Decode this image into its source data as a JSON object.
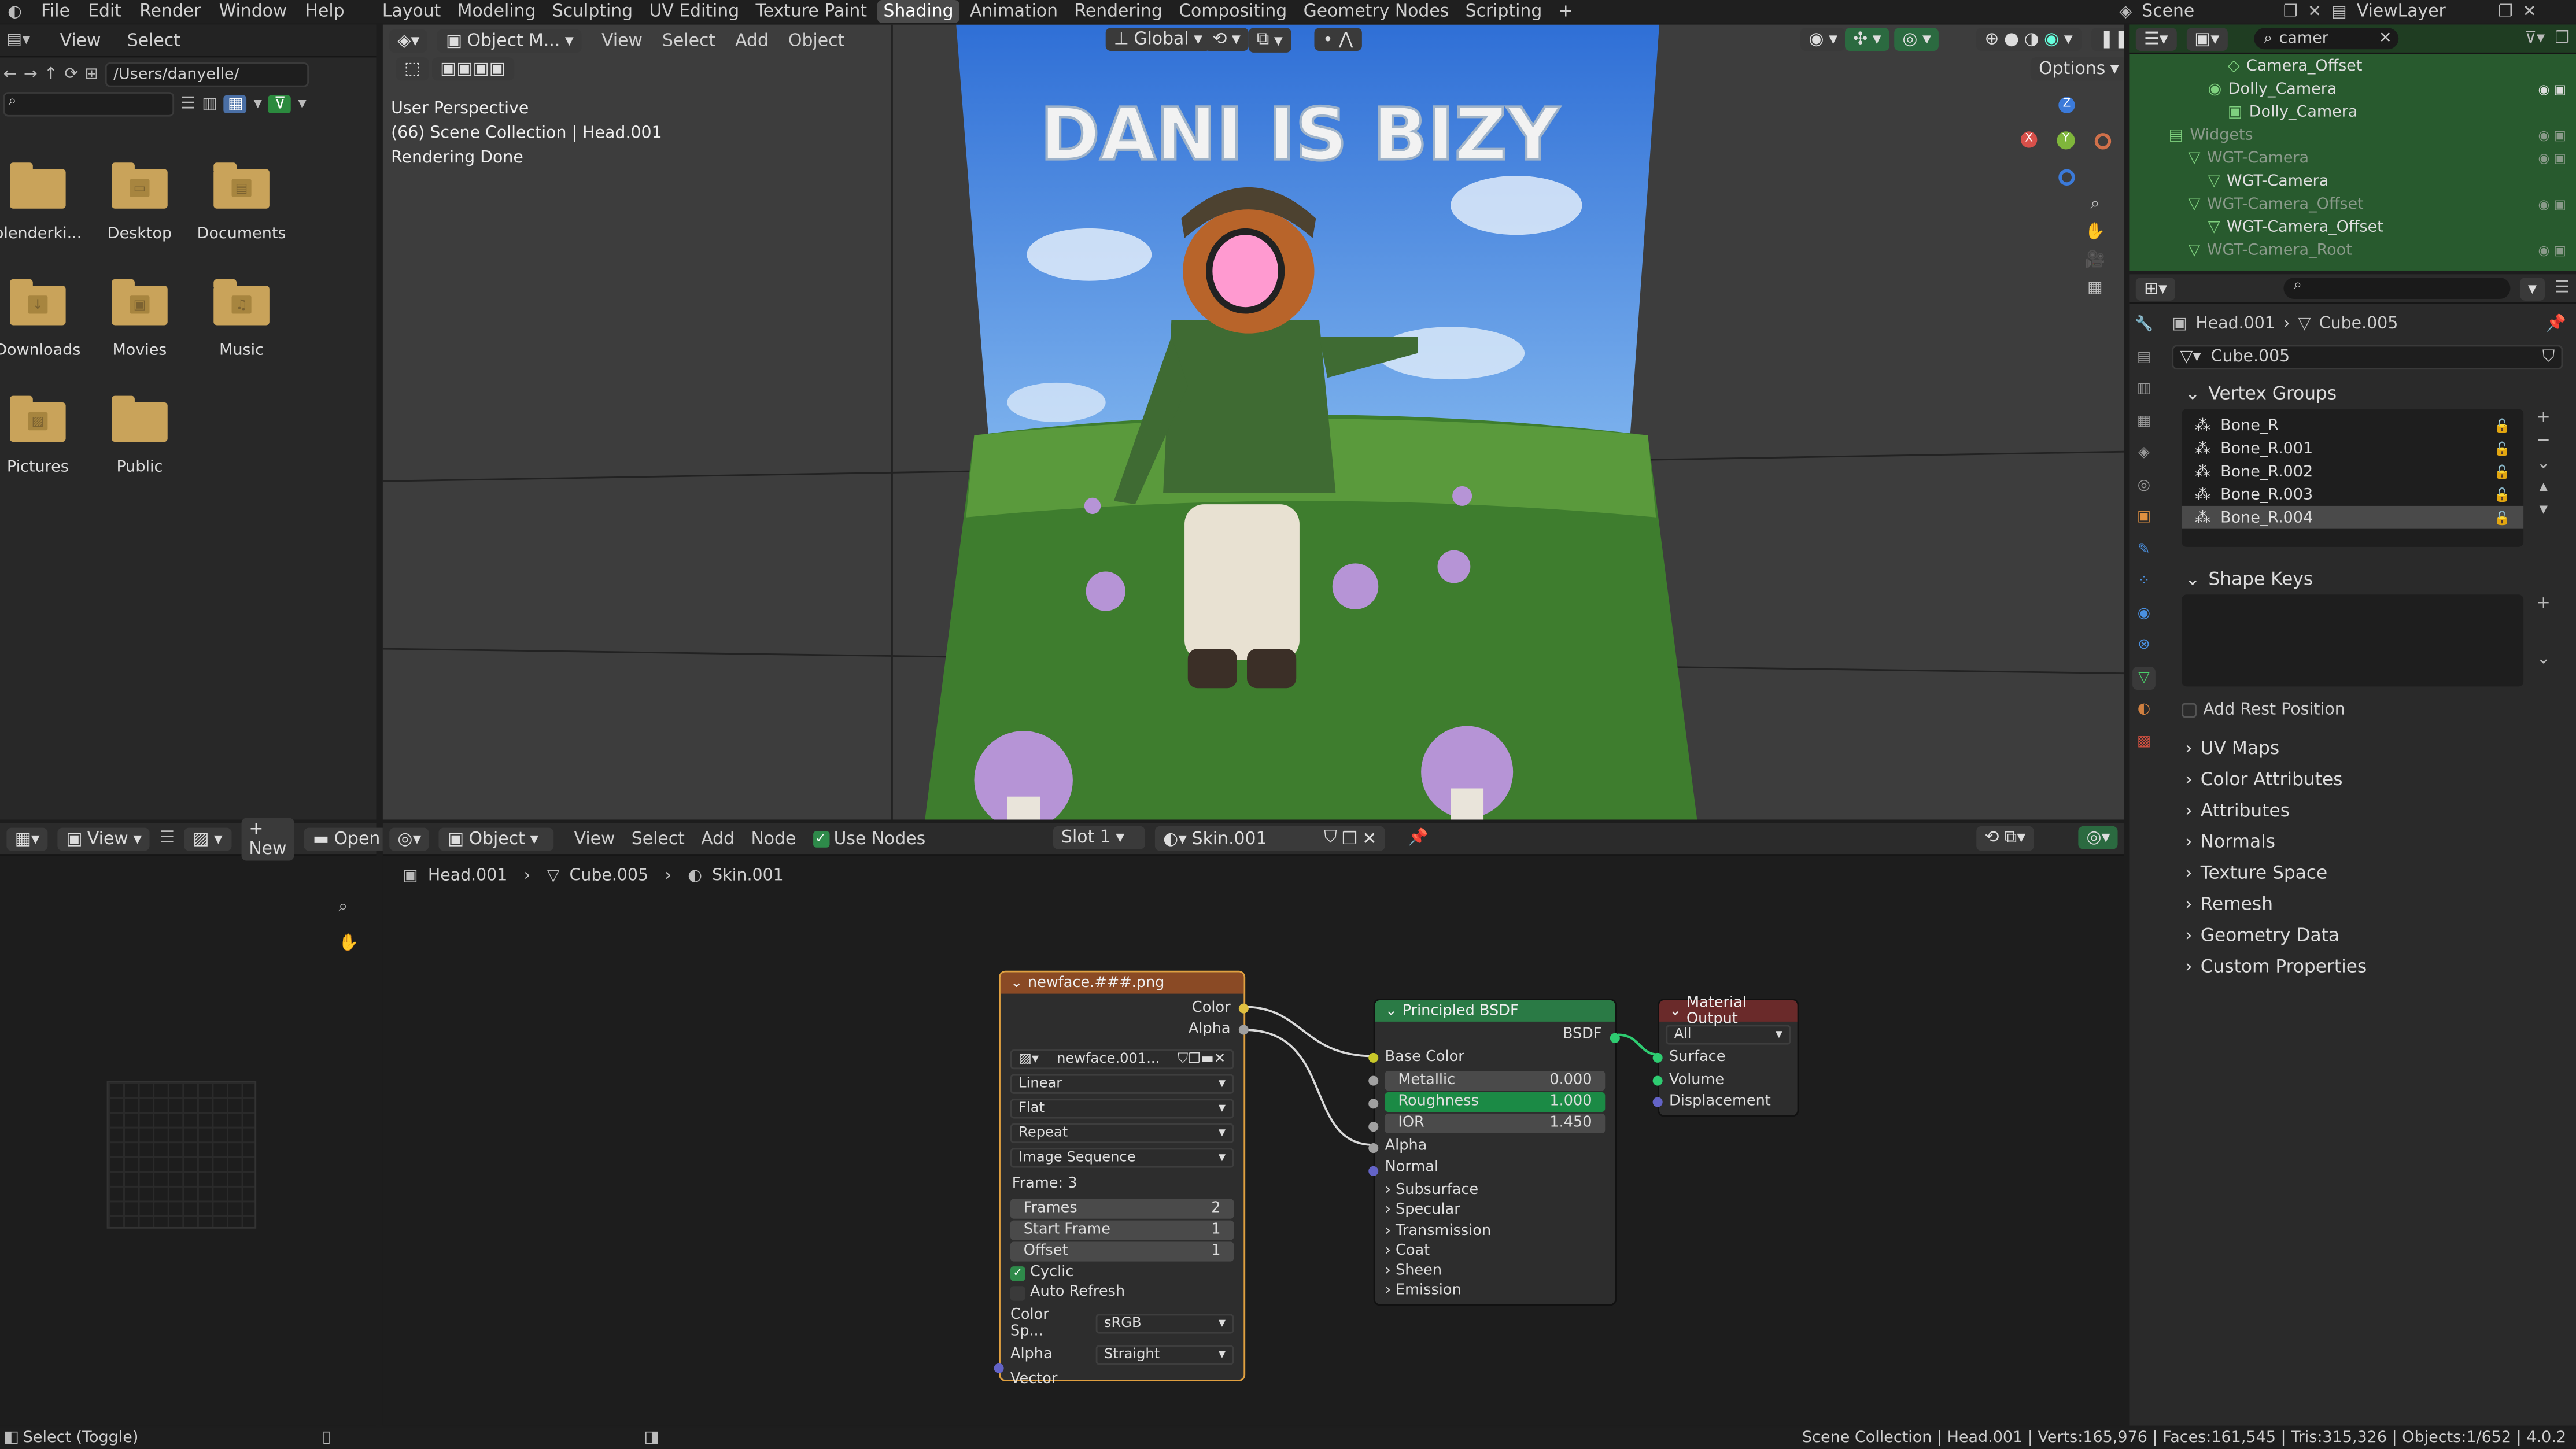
{
  "topbar": {
    "menus": [
      "File",
      "Edit",
      "Render",
      "Window",
      "Help"
    ],
    "workspaces": [
      "Layout",
      "Modeling",
      "Sculpting",
      "UV Editing",
      "Texture Paint",
      "Shading",
      "Animation",
      "Rendering",
      "Compositing",
      "Geometry Nodes",
      "Scripting"
    ],
    "active_workspace": "Shading",
    "add_tab": "+",
    "scene": "Scene",
    "view_layer": "ViewLayer"
  },
  "filebrowser": {
    "menus": [
      "View",
      "Select"
    ],
    "path": "/Users/danyelle/",
    "items": [
      {
        "label": "blenderki...",
        "glyph": ""
      },
      {
        "label": "Desktop",
        "glyph": "▭"
      },
      {
        "label": "Documents",
        "glyph": "▤"
      },
      {
        "label": "Downloads",
        "glyph": "↓"
      },
      {
        "label": "Movies",
        "glyph": "▣"
      },
      {
        "label": "Music",
        "glyph": "♫"
      },
      {
        "label": "Pictures",
        "glyph": "▨"
      },
      {
        "label": "Public",
        "glyph": ""
      }
    ]
  },
  "viewport": {
    "mode": "Object M...",
    "menus": [
      "View",
      "Select",
      "Add",
      "Object"
    ],
    "orientation": "Global",
    "options": "Options",
    "info_lines": [
      "User Perspective",
      "(66) Scene Collection | Head.001",
      "Rendering Done"
    ],
    "poster_title": "DANI IS BIZY"
  },
  "imgeditor": {
    "view": "View",
    "new_label": "+ New",
    "open_label": "Open"
  },
  "nodeeditor": {
    "type": "Object",
    "menus": [
      "View",
      "Select",
      "Add",
      "Node"
    ],
    "use_nodes_label": "Use Nodes",
    "slot": "Slot 1",
    "material": "Skin.001",
    "breadcrumb": [
      "Head.001",
      "Cube.005",
      "Skin.001"
    ],
    "image_node": {
      "title": "newface.###.png",
      "out_color": "Color",
      "out_alpha": "Alpha",
      "image_name": "newface.001...",
      "interpolation": "Linear",
      "projection": "Flat",
      "extension": "Repeat",
      "source": "Image Sequence",
      "frame_label": "Frame: 3",
      "frames_label": "Frames",
      "frames_value": "2",
      "start_label": "Start Frame",
      "start_value": "1",
      "offset_label": "Offset",
      "offset_value": "1",
      "cyclic": "Cyclic",
      "auto_refresh": "Auto Refresh",
      "colorspace_label": "Color Sp...",
      "colorspace_value": "sRGB",
      "alpha_label": "Alpha",
      "alpha_value": "Straight",
      "vector": "Vector"
    },
    "bsdf_node": {
      "title": "Principled BSDF",
      "out": "BSDF",
      "base_color": "Base Color",
      "metallic_label": "Metallic",
      "metallic_value": "0.000",
      "roughness_label": "Roughness",
      "roughness_value": "1.000",
      "ior_label": "IOR",
      "ior_value": "1.450",
      "alpha": "Alpha",
      "normal": "Normal",
      "sections": [
        "Subsurface",
        "Specular",
        "Transmission",
        "Coat",
        "Sheen",
        "Emission"
      ]
    },
    "output_node": {
      "title": "Material Output",
      "target": "All",
      "inputs": [
        "Surface",
        "Volume",
        "Displacement"
      ]
    }
  },
  "outliner": {
    "search": "camer",
    "rows": [
      {
        "label": "Camera_Offset",
        "indent": 5,
        "glyph": "◇",
        "color": "#ddd"
      },
      {
        "label": "Dolly_Camera",
        "indent": 4,
        "glyph": "◉",
        "color": "#ddd"
      },
      {
        "label": "Dolly_Camera",
        "indent": 5,
        "glyph": "▣",
        "color": "#ddd"
      },
      {
        "label": "Widgets",
        "indent": 2,
        "glyph": "▤",
        "color": "#8a9a8a"
      },
      {
        "label": "WGT-Camera",
        "indent": 3,
        "glyph": "▽",
        "color": "#8a9a8a"
      },
      {
        "label": "WGT-Camera",
        "indent": 4,
        "glyph": "▽",
        "color": "#ddd"
      },
      {
        "label": "WGT-Camera_Offset",
        "indent": 3,
        "glyph": "▽",
        "color": "#8a9a8a"
      },
      {
        "label": "WGT-Camera_Offset",
        "indent": 4,
        "glyph": "▽",
        "color": "#ddd"
      },
      {
        "label": "WGT-Camera_Root",
        "indent": 3,
        "glyph": "▽",
        "color": "#8a9a8a"
      }
    ]
  },
  "properties": {
    "breadcrumb_object": "Head.001",
    "breadcrumb_mesh": "Cube.005",
    "mesh_name": "Cube.005",
    "vertex_groups_label": "Vertex Groups",
    "vertex_groups": [
      "Bone_R",
      "Bone_R.001",
      "Bone_R.002",
      "Bone_R.003",
      "Bone_R.004"
    ],
    "active_group": "Bone_R.004",
    "shape_keys_label": "Shape Keys",
    "add_rest_position": "Add Rest Position",
    "panels": [
      "UV Maps",
      "Color Attributes",
      "Attributes",
      "Normals",
      "Texture Space",
      "Remesh",
      "Geometry Data",
      "Custom Properties"
    ]
  },
  "statusbar": {
    "left": "Select (Toggle)",
    "stats": "Scene Collection | Head.001 | Verts:165,976 | Faces:161,545 | Tris:315,326 | Objects:1/652 | 4.0.2"
  }
}
